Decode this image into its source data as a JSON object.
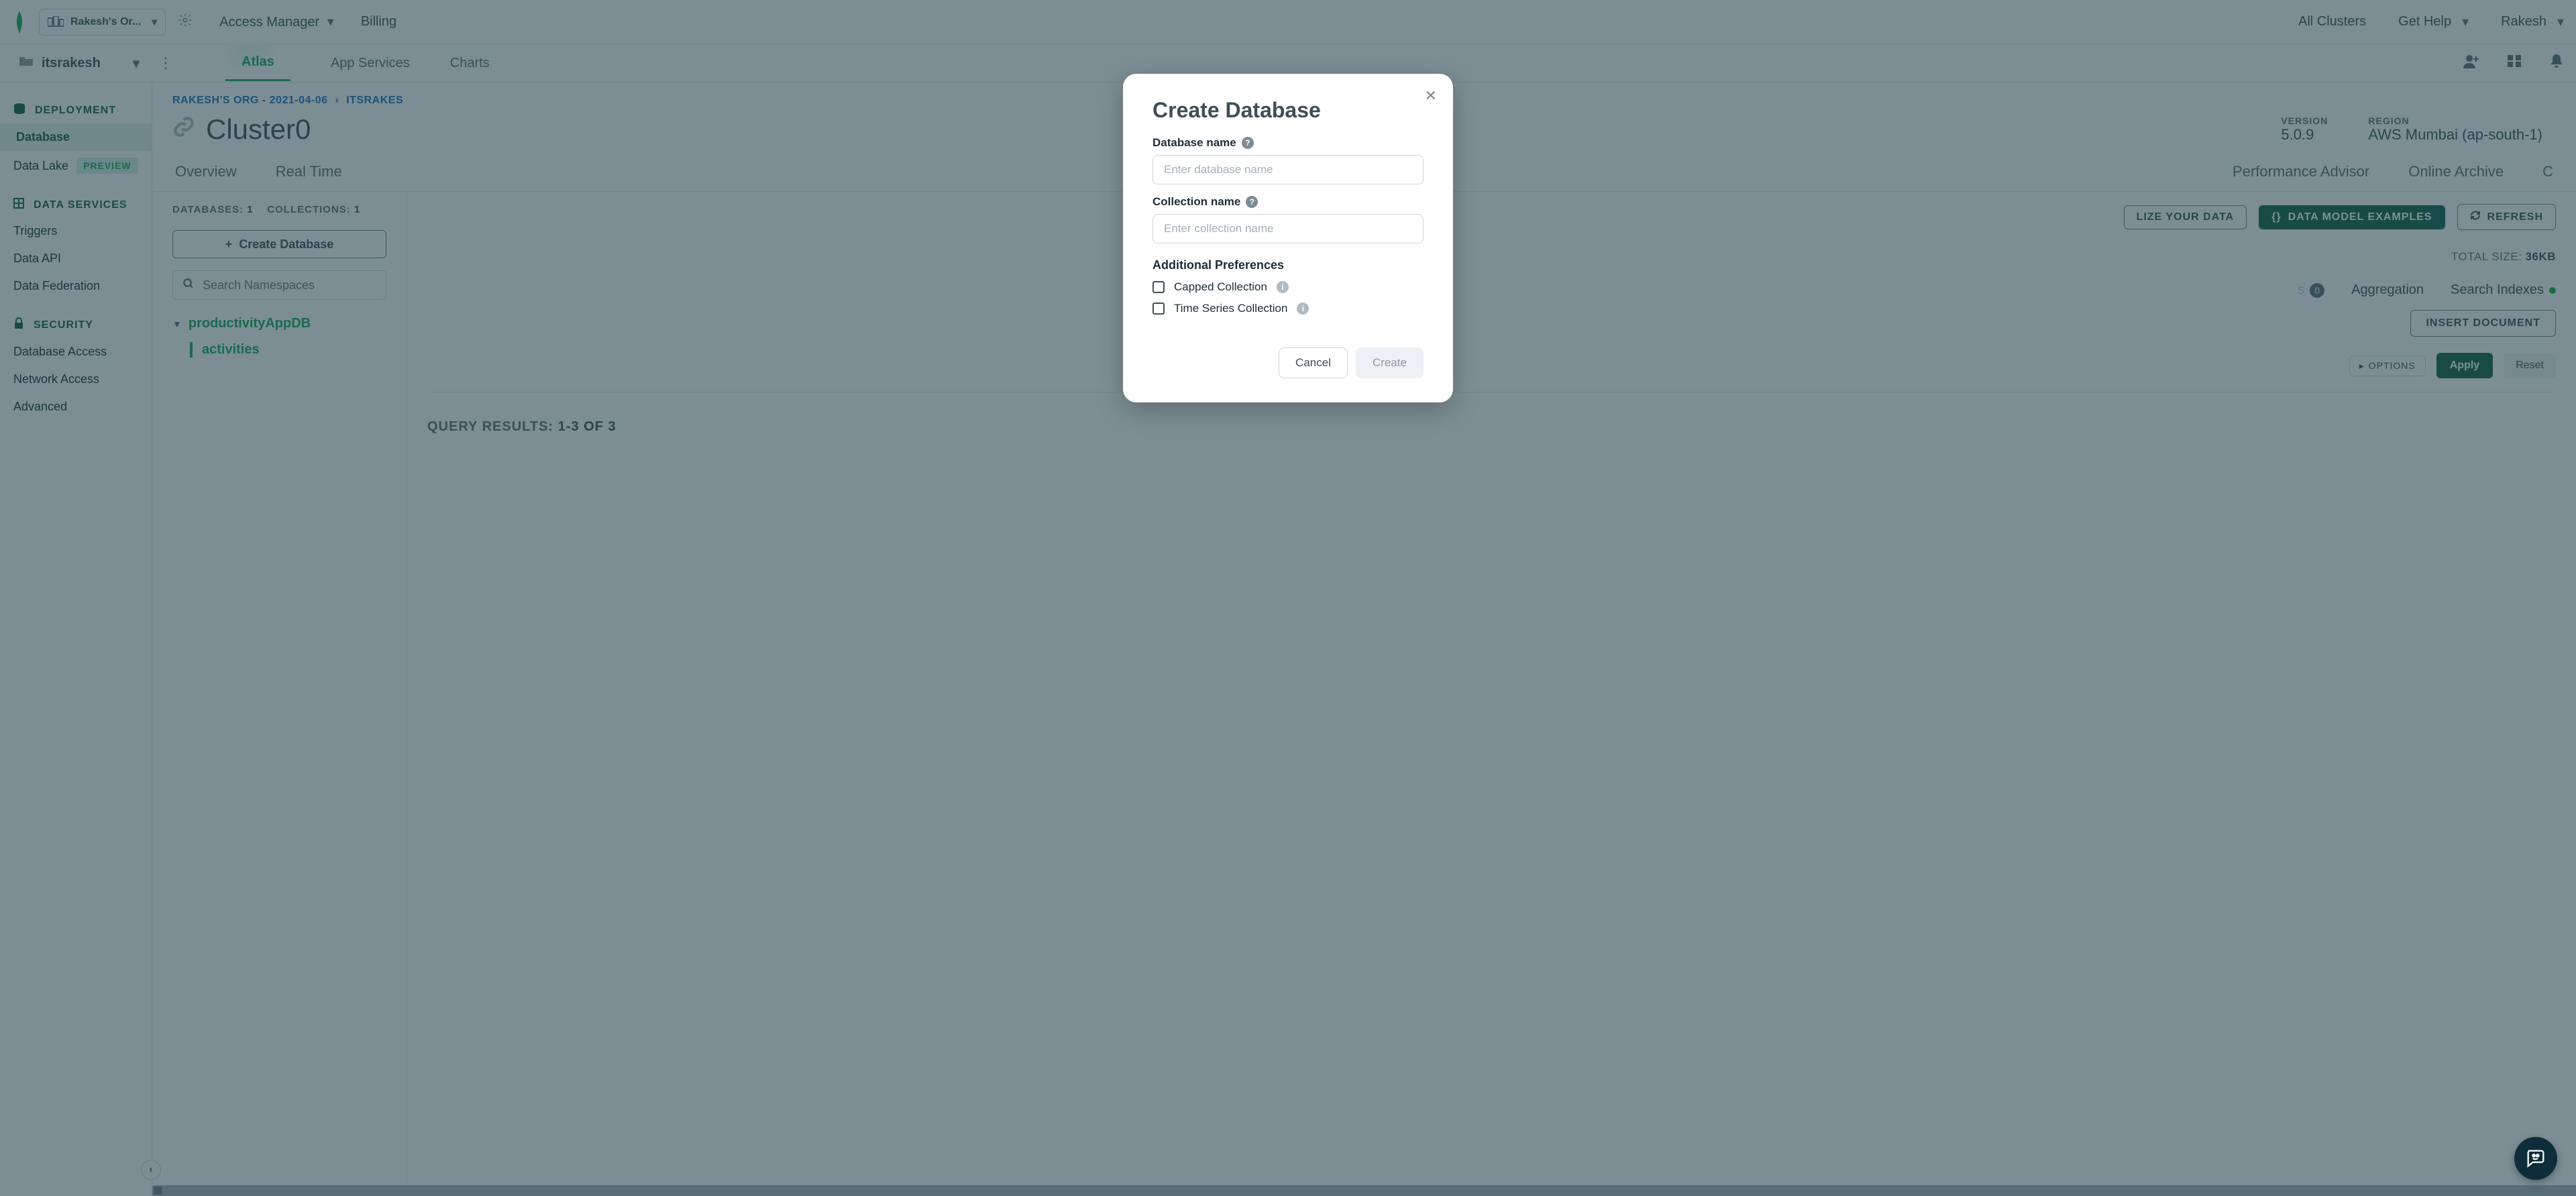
{
  "topbar": {
    "org_name": "Rakesh's Or...",
    "access_manager": "Access Manager",
    "billing": "Billing",
    "all_clusters": "All Clusters",
    "get_help": "Get Help",
    "user": "Rakesh"
  },
  "secondbar": {
    "project": "itsrakesh",
    "tabs": {
      "atlas": "Atlas",
      "app_services": "App Services",
      "charts": "Charts"
    }
  },
  "sidebar": {
    "deployment": "DEPLOYMENT",
    "database": "Database",
    "data_lake": "Data Lake",
    "preview": "PREVIEW",
    "data_services": "DATA SERVICES",
    "triggers": "Triggers",
    "data_api": "Data API",
    "data_federation": "Data Federation",
    "security": "SECURITY",
    "database_access": "Database Access",
    "network_access": "Network Access",
    "advanced": "Advanced"
  },
  "breadcrumb": {
    "org": "RAKESH'S ORG - 2021-04-06",
    "proj": "ITSRAKES"
  },
  "cluster": {
    "name": "Cluster0",
    "version_label": "VERSION",
    "version": "5.0.9",
    "region_label": "REGION",
    "region": "AWS Mumbai (ap-south-1)"
  },
  "tabs": {
    "overview": "Overview",
    "real_time": "Real Time",
    "perf": "Performance Advisor",
    "online_archive": "Online Archive",
    "c": "C"
  },
  "dbpanel": {
    "databases_label": "DATABASES:",
    "databases_count": "1",
    "collections_label": "COLLECTIONS:",
    "collections_count": "1",
    "create_db": "Create Database",
    "search_placeholder": "Search Namespaces",
    "db_name": "productivityAppDB",
    "coll_name": "activities"
  },
  "actions": {
    "visualize": "LIZE YOUR DATA",
    "data_model": "DATA MODEL EXAMPLES",
    "refresh": "REFRESH"
  },
  "dataline": {
    "total_size_label": "TOTAL SIZE:",
    "total_size": "36KB"
  },
  "subtabs": {
    "badge_zero": "0",
    "aggregation": "Aggregation",
    "search_indexes": "Search Indexes"
  },
  "insert_document": "INSERT DOCUMENT",
  "filter": {
    "options": "OPTIONS",
    "apply": "Apply",
    "reset": "Reset"
  },
  "query_results": {
    "label": "QUERY RESULTS:",
    "value": "1-3 OF 3"
  },
  "modal": {
    "title": "Create Database",
    "db_label": "Database name",
    "db_placeholder": "Enter database name",
    "coll_label": "Collection name",
    "coll_placeholder": "Enter collection name",
    "prefs": "Additional Preferences",
    "capped": "Capped Collection",
    "timeseries": "Time Series Collection",
    "cancel": "Cancel",
    "create": "Create"
  }
}
